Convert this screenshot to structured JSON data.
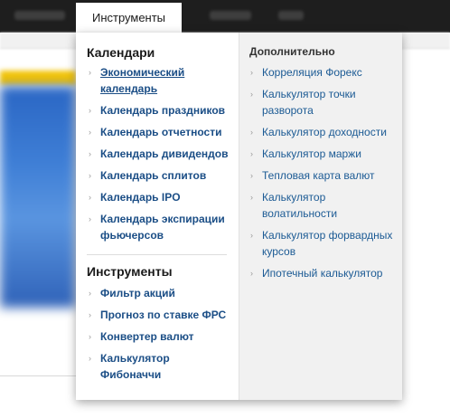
{
  "top_nav": {
    "active_tab": "Инструменты"
  },
  "dropdown": {
    "left": {
      "calendars_heading": "Календари",
      "calendar_items": [
        "Экономический календарь",
        "Календарь праздников",
        "Календарь отчетности",
        "Календарь дивидендов",
        "Календарь сплитов",
        "Календарь IPO",
        "Календарь экспирации фьючерсов"
      ],
      "tools_heading": "Инструменты",
      "tool_items": [
        "Фильтр акций",
        "Прогноз по ставке ФРС",
        "Конвертер валют",
        "Калькулятор Фибоначчи"
      ]
    },
    "right": {
      "heading": "Дополнительно",
      "items": [
        "Корреляция Форекс",
        "Калькулятор точки разворота",
        "Калькулятор доходности",
        "Калькулятор маржи",
        "Тепловая карта валют",
        "Калькулятор волатильности",
        "Калькулятор форвардных курсов",
        "Ипотечный калькулятор"
      ]
    }
  },
  "icons": {
    "bullet": "chevron-right-icon"
  },
  "colors": {
    "topbar": "#1e1e1e",
    "link_bold": "#1b4e86",
    "link": "#1b5a94",
    "panel_right_bg": "#f1f1f1"
  }
}
